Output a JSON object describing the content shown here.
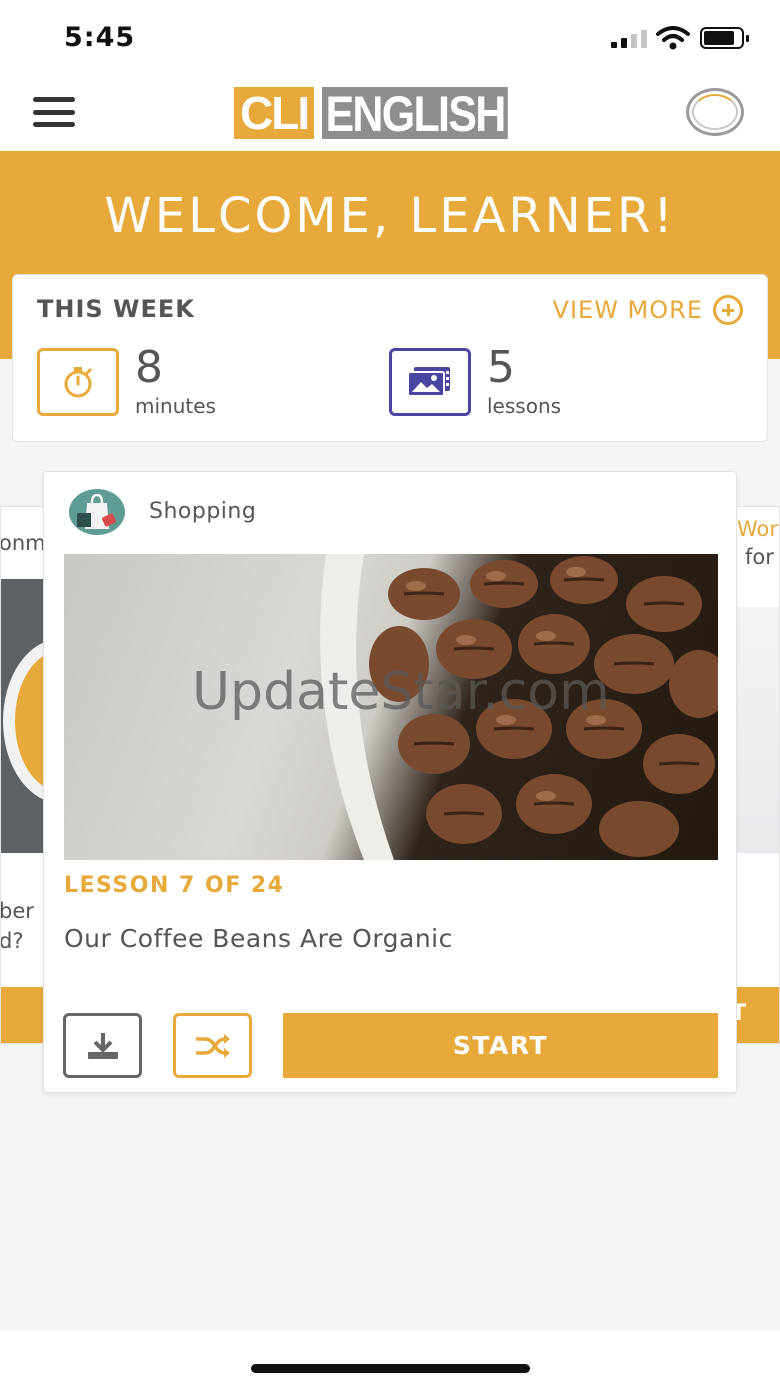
{
  "status_bar": {
    "time": "5:45"
  },
  "header": {
    "logo_mark": "CLI",
    "logo_word": "ENGLISH"
  },
  "banner": {
    "welcome": "WELCOME, LEARNER!"
  },
  "this_week": {
    "title": "THIS WEEK",
    "view_more": "VIEW MORE",
    "minutes": {
      "value": "8",
      "unit": "minutes",
      "icon": "stopwatch-icon"
    },
    "lessons": {
      "value": "5",
      "unit": "lessons",
      "icon": "image-lesson-icon"
    }
  },
  "lesson_card": {
    "topic": "Shopping",
    "watermark": "UpdateStar.com",
    "lesson_count": "LESSON 7 OF 24",
    "title": "Our Coffee Beans Are Organic",
    "start_label": "START",
    "download_icon": "download-icon",
    "shuffle_icon": "shuffle-icon"
  },
  "left_peek_card": {
    "line1": "onm",
    "line2": "ber",
    "line3": "d?"
  },
  "right_peek_card": {
    "line1": "Wor",
    "line2": "for",
    "button": "T"
  },
  "colors": {
    "accent": "#e6a93a",
    "purple": "#4a45a0",
    "text": "#555555"
  }
}
